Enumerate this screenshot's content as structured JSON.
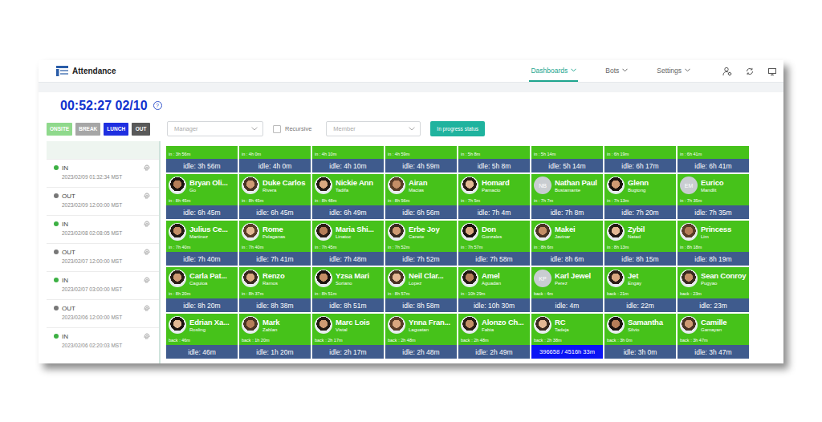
{
  "window": {
    "title": "Attendance"
  },
  "nav": [
    {
      "label": "Dashboards",
      "selected": true
    },
    {
      "label": "Bots",
      "selected": false
    },
    {
      "label": "Settings",
      "selected": false
    }
  ],
  "clock": {
    "time": "00:52:27 02/10",
    "help": "?"
  },
  "status_buttons": [
    {
      "label": "ONSITE",
      "color": "#8fd98c"
    },
    {
      "label": "BREAK",
      "color": "#a6a6a6"
    },
    {
      "label": "LUNCH",
      "color": "#1f2fe0"
    },
    {
      "label": "OUT",
      "color": "#595959"
    }
  ],
  "filters": {
    "manager": {
      "placeholder": "Manager"
    },
    "recursive": {
      "label": "Recursive",
      "checked": false
    },
    "member": {
      "placeholder": "Member"
    },
    "button": "In progress status"
  },
  "log": [
    {
      "status": "IN",
      "time": "2023/02/09 01:32:34 MST",
      "color": "#3cb043"
    },
    {
      "status": "OUT",
      "time": "2023/02/09 12:00:00 MST",
      "color": "#777777"
    },
    {
      "status": "IN",
      "time": "2023/02/08 02:08:05 MST",
      "color": "#3cb043"
    },
    {
      "status": "OUT",
      "time": "2023/02/07 12:00:00 MST",
      "color": "#777777"
    },
    {
      "status": "IN",
      "time": "2023/02/07 03:00:00 MST",
      "color": "#3cb043"
    },
    {
      "status": "OUT",
      "time": "2023/02/06 12:00:00 MST",
      "color": "#777777"
    },
    {
      "status": "IN",
      "time": "2023/02/06 02:20:03 MST",
      "color": "#3cb043"
    }
  ],
  "cards": [
    {
      "kind": "partial",
      "status": "in : 3h 56m",
      "meter": "idle: 3h 56m",
      "alert": false
    },
    {
      "kind": "partial",
      "status": "in : 4h 0m",
      "meter": "idle: 4h 0m",
      "alert": false
    },
    {
      "kind": "partial",
      "status": "in : 4h 10m",
      "meter": "idle: 4h 10m",
      "alert": false
    },
    {
      "kind": "partial",
      "status": "in : 4h 59m",
      "meter": "idle: 4h 59m",
      "alert": false
    },
    {
      "kind": "partial",
      "status": "in : 5h 8m",
      "meter": "idle: 5h 8m",
      "alert": false
    },
    {
      "kind": "partial",
      "status": "in : 5h 14m",
      "meter": "idle: 5h 14m",
      "alert": false
    },
    {
      "kind": "partial",
      "status": "in : 6h 19m",
      "meter": "idle: 6h 17m",
      "alert": false
    },
    {
      "kind": "partial",
      "status": "in : 6h 41m",
      "meter": "idle: 6h 41m",
      "alert": false
    },
    {
      "kind": "full",
      "name": "Bryan Oli...",
      "surname": "Go",
      "avatar": "photo",
      "initials": "",
      "status": "in : 8h 45m",
      "meter": "idle: 6h 45m",
      "alert": false
    },
    {
      "kind": "full",
      "name": "Duke Carlos",
      "surname": "Rivera",
      "avatar": "photo",
      "initials": "",
      "status": "in : 8h 45m",
      "meter": "idle: 6h 45m",
      "alert": false
    },
    {
      "kind": "full",
      "name": "Nickie Ann",
      "surname": "Tadifa",
      "avatar": "photo",
      "initials": "",
      "status": "in : 8h 48m",
      "meter": "idle: 6h 49m",
      "alert": false
    },
    {
      "kind": "full",
      "name": "Airan",
      "surname": "Macias",
      "avatar": "photo",
      "initials": "",
      "status": "in : 8h 56m",
      "meter": "idle: 6h 56m",
      "alert": false
    },
    {
      "kind": "full",
      "name": "Homard",
      "surname": "Pamacio",
      "avatar": "photo",
      "initials": "",
      "status": "in : 7h 5m",
      "meter": "idle: 7h 4m",
      "alert": false
    },
    {
      "kind": "full",
      "name": "Nathan Paul",
      "surname": "Bustamante",
      "avatar": "initials",
      "initials": "NB",
      "status": "in : 7h 7m",
      "meter": "idle: 7h 8m",
      "alert": false
    },
    {
      "kind": "full",
      "name": "Glenn",
      "surname": "Bugtong",
      "avatar": "photo",
      "initials": "",
      "status": "in : 7h 13m",
      "meter": "idle: 7h 20m",
      "alert": false
    },
    {
      "kind": "full",
      "name": "Eurico",
      "surname": "Mandlit",
      "avatar": "initials",
      "initials": "EM",
      "status": "in : 7h 35m",
      "meter": "idle: 7h 35m",
      "alert": false
    },
    {
      "kind": "full",
      "name": "Julius Ce...",
      "surname": "Martinez",
      "avatar": "photo",
      "initials": "",
      "status": "in : 7h 40m",
      "meter": "idle: 7h 40m",
      "alert": false
    },
    {
      "kind": "full",
      "name": "Rome",
      "surname": "Pelaganas",
      "avatar": "photo",
      "initials": "",
      "status": "in : 7h 40m",
      "meter": "idle: 7h 41m",
      "alert": false
    },
    {
      "kind": "full",
      "name": "Maria Shi...",
      "surname": "Linatoc",
      "avatar": "photo",
      "initials": "",
      "status": "in : 7h 45m",
      "meter": "idle: 7h 48m",
      "alert": false
    },
    {
      "kind": "full",
      "name": "Erbe Joy",
      "surname": "Canete",
      "avatar": "photo",
      "initials": "",
      "status": "in : 7h 52m",
      "meter": "idle: 7h 52m",
      "alert": false
    },
    {
      "kind": "full",
      "name": "Don",
      "surname": "Gonzales",
      "avatar": "photo",
      "initials": "",
      "status": "in : 7h 57m",
      "meter": "idle: 7h 58m",
      "alert": false
    },
    {
      "kind": "full",
      "name": "Makei",
      "surname": "Javinar",
      "avatar": "photo",
      "initials": "",
      "status": "in : 8h 6m",
      "meter": "idle: 8h 6m",
      "alert": false
    },
    {
      "kind": "full",
      "name": "Zybil",
      "surname": "Natad",
      "avatar": "photo",
      "initials": "",
      "status": "in : 8h 13m",
      "meter": "idle: 8h 15m",
      "alert": false
    },
    {
      "kind": "full",
      "name": "Princess",
      "surname": "Lim",
      "avatar": "photo",
      "initials": "",
      "status": "in : 8h 18m",
      "meter": "idle: 8h 19m",
      "alert": false
    },
    {
      "kind": "full",
      "name": "Carla Pat...",
      "surname": "Caguioa",
      "avatar": "photo",
      "initials": "",
      "status": "in : 8h 20m",
      "meter": "idle: 8h 20m",
      "alert": false
    },
    {
      "kind": "full",
      "name": "Renzo",
      "surname": "Ramos",
      "avatar": "photo",
      "initials": "",
      "status": "in : 8h 37m",
      "meter": "idle: 8h 38m",
      "alert": false
    },
    {
      "kind": "full",
      "name": "Yzsa Mari",
      "surname": "Soriano",
      "avatar": "photo",
      "initials": "",
      "status": "in : 8h 51m",
      "meter": "idle: 8h 51m",
      "alert": false
    },
    {
      "kind": "full",
      "name": "Neil Clar...",
      "surname": "Lopez",
      "avatar": "photo",
      "initials": "",
      "status": "in : 8h 57m",
      "meter": "idle: 8h 58m",
      "alert": false
    },
    {
      "kind": "full",
      "name": "Amel",
      "surname": "Aguadan",
      "avatar": "photo",
      "initials": "",
      "status": "in : 10h 29m",
      "meter": "idle: 10h 30m",
      "alert": false
    },
    {
      "kind": "full",
      "name": "Karl Jewel",
      "surname": "Perez",
      "avatar": "initials",
      "initials": "KP",
      "status": "back : 4m",
      "meter": "idle: 4m",
      "alert": false
    },
    {
      "kind": "full",
      "name": "Jet",
      "surname": "Engay",
      "avatar": "photo",
      "initials": "",
      "status": "back : 21m",
      "meter": "idle: 22m",
      "alert": false
    },
    {
      "kind": "full",
      "name": "Sean Conroy",
      "surname": "Pugyao",
      "avatar": "photo",
      "initials": "",
      "status": "back : 23m",
      "meter": "idle: 23m",
      "alert": false
    },
    {
      "kind": "full",
      "name": "Edrian Xa...",
      "surname": "Rosling",
      "avatar": "photo",
      "initials": "",
      "status": "back : 46m",
      "meter": "idle: 46m",
      "alert": false
    },
    {
      "kind": "full",
      "name": "Mark",
      "surname": "Zablan",
      "avatar": "photo",
      "initials": "",
      "status": "back : 1h 20m",
      "meter": "idle: 1h 20m",
      "alert": false
    },
    {
      "kind": "full",
      "name": "Marc Lois",
      "surname": "Vistal",
      "avatar": "photo",
      "initials": "",
      "status": "back : 2h 17m",
      "meter": "idle: 2h 17m",
      "alert": false
    },
    {
      "kind": "full",
      "name": "Ynna Fran...",
      "surname": "Laguatan",
      "avatar": "photo",
      "initials": "",
      "status": "back : 2h 48m",
      "meter": "idle: 2h 48m",
      "alert": false
    },
    {
      "kind": "full",
      "name": "Alonzo Ch...",
      "surname": "Fabia",
      "avatar": "photo",
      "initials": "",
      "status": "back : 2h 48m",
      "meter": "idle: 2h 49m",
      "alert": false
    },
    {
      "kind": "full",
      "name": "RC",
      "surname": "Tadeja",
      "avatar": "photo",
      "initials": "",
      "status": "back : 2h 38m",
      "meter": "396658 / 4516h 33m",
      "alert": true
    },
    {
      "kind": "full",
      "name": "Samantha",
      "surname": "Silvio",
      "avatar": "photo",
      "initials": "",
      "status": "back : 3h 0m",
      "meter": "idle: 3h 0m",
      "alert": false
    },
    {
      "kind": "full",
      "name": "Camille",
      "surname": "Gamayan",
      "avatar": "photo",
      "initials": "",
      "status": "back : 3h 47m",
      "meter": "idle: 3h 47m",
      "alert": false
    }
  ]
}
